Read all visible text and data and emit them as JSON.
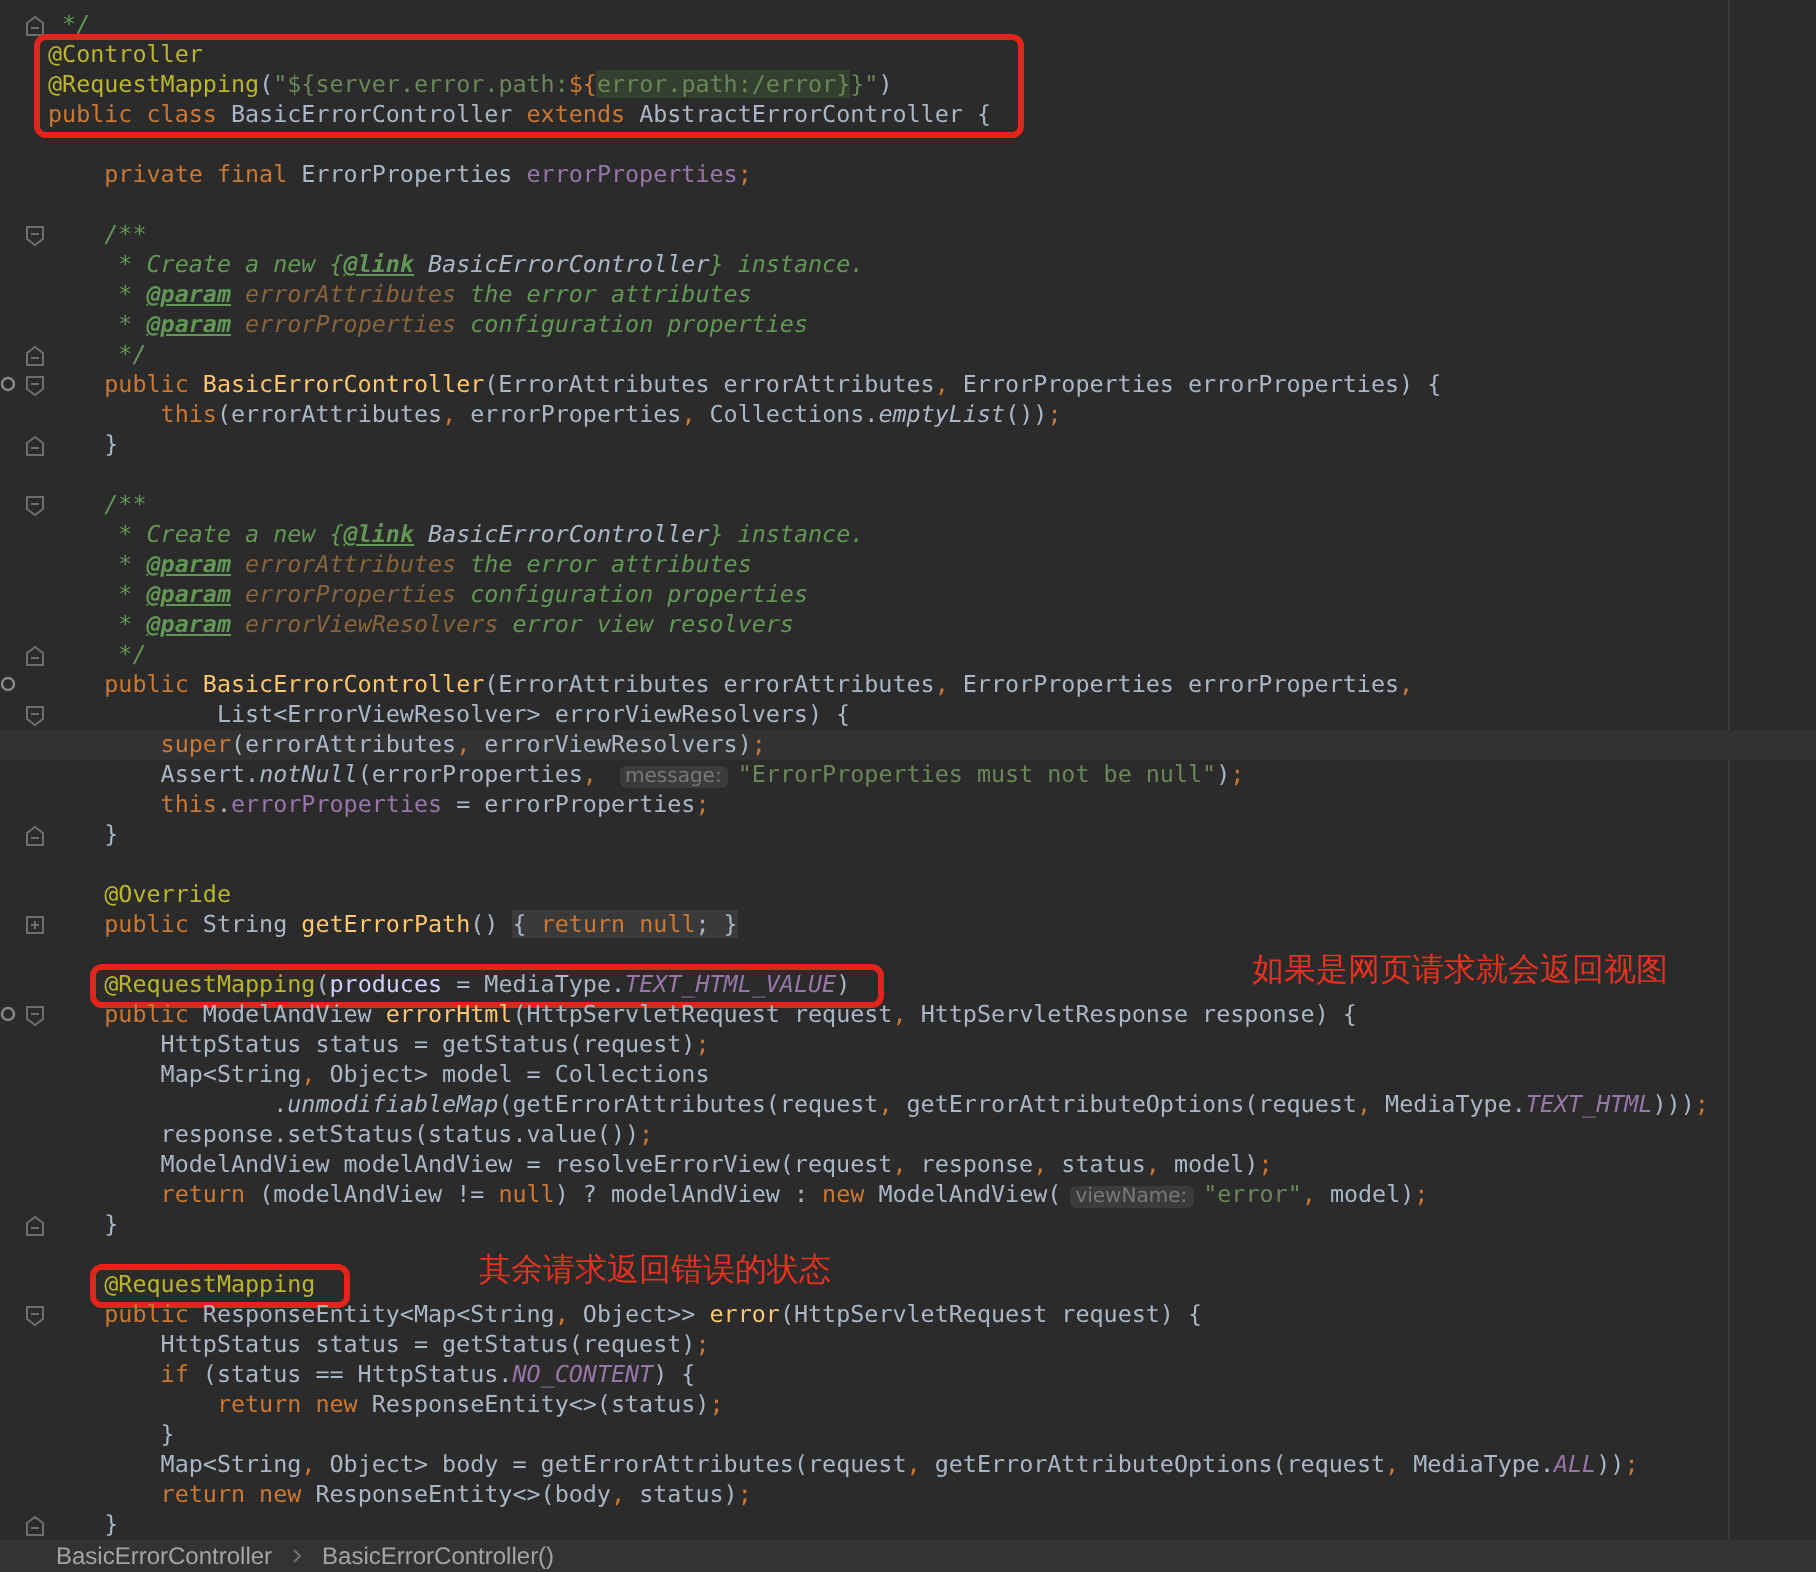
{
  "lines": [
    {
      "kind": "code",
      "fold_end": true,
      "tokens": [
        {
          "kind": "comment",
          "text": " */"
        }
      ]
    },
    {
      "kind": "code",
      "boxed": true,
      "tokens": [
        {
          "kind": "annotation",
          "text": "@Controller"
        }
      ]
    },
    {
      "kind": "code",
      "boxed": true,
      "tokens": [
        {
          "kind": "annotation",
          "text": "@RequestMapping"
        },
        {
          "kind": "plain",
          "text": "("
        },
        {
          "kind": "string",
          "text": "\"${server.error.path:"
        },
        {
          "kind": "keyword",
          "text": "${"
        },
        {
          "kind": "template",
          "text": "error.path:/error}"
        },
        {
          "kind": "string",
          "text": "}\""
        },
        {
          "kind": "plain",
          "text": ")"
        }
      ]
    },
    {
      "kind": "code",
      "boxed": true,
      "tokens": [
        {
          "kind": "keyword",
          "text": "public class "
        },
        {
          "kind": "plain",
          "text": "BasicErrorController "
        },
        {
          "kind": "keyword",
          "text": "extends "
        },
        {
          "kind": "plain",
          "text": "AbstractErrorController {"
        }
      ]
    },
    {
      "kind": "blank"
    },
    {
      "kind": "code",
      "tokens": [
        {
          "kind": "keyword",
          "text": "    private final "
        },
        {
          "kind": "plain",
          "text": "ErrorProperties "
        },
        {
          "kind": "field",
          "text": "errorProperties"
        },
        {
          "kind": "plain",
          "text": ";"
        }
      ]
    },
    {
      "kind": "blank"
    },
    {
      "kind": "code",
      "fold_start": true,
      "tokens": [
        {
          "kind": "comment",
          "text": "    /**"
        }
      ]
    },
    {
      "kind": "code",
      "tokens": [
        {
          "kind": "comment",
          "text": "     * Create a new {"
        },
        {
          "kind": "doctag",
          "text": "@link"
        },
        {
          "kind": "docref",
          "text": " BasicErrorController"
        },
        {
          "kind": "comment",
          "text": "} instance."
        }
      ]
    },
    {
      "kind": "code",
      "tokens": [
        {
          "kind": "comment",
          "text": "     * "
        },
        {
          "kind": "doctag",
          "text": "@param"
        },
        {
          "kind": "docparam",
          "text": " errorAttributes"
        },
        {
          "kind": "comment",
          "text": " the error attributes"
        }
      ]
    },
    {
      "kind": "code",
      "tokens": [
        {
          "kind": "comment",
          "text": "     * "
        },
        {
          "kind": "doctag",
          "text": "@param"
        },
        {
          "kind": "docparam",
          "text": " errorProperties"
        },
        {
          "kind": "comment",
          "text": " configuration properties"
        }
      ]
    },
    {
      "kind": "code",
      "fold_end": true,
      "tokens": [
        {
          "kind": "comment",
          "text": "     */"
        }
      ]
    },
    {
      "kind": "code",
      "fold_start": true,
      "marker": true,
      "tokens": [
        {
          "kind": "keyword",
          "text": "    public "
        },
        {
          "kind": "declaration",
          "text": "BasicErrorController"
        },
        {
          "kind": "plain",
          "text": "(ErrorAttributes errorAttributes, ErrorProperties errorProperties) {"
        }
      ]
    },
    {
      "kind": "code",
      "tokens": [
        {
          "kind": "keyword",
          "text": "        this"
        },
        {
          "kind": "plain",
          "text": "(errorAttributes, errorProperties, Collections."
        },
        {
          "kind": "italic",
          "text": "emptyList"
        },
        {
          "kind": "plain",
          "text": "());"
        }
      ]
    },
    {
      "kind": "code",
      "fold_end": true,
      "tokens": [
        {
          "kind": "plain",
          "text": "    }"
        }
      ]
    },
    {
      "kind": "blank"
    },
    {
      "kind": "code",
      "fold_start": true,
      "tokens": [
        {
          "kind": "comment",
          "text": "    /**"
        }
      ]
    },
    {
      "kind": "code",
      "tokens": [
        {
          "kind": "comment",
          "text": "     * Create a new {"
        },
        {
          "kind": "doctag",
          "text": "@link"
        },
        {
          "kind": "docref",
          "text": " BasicErrorController"
        },
        {
          "kind": "comment",
          "text": "} instance."
        }
      ]
    },
    {
      "kind": "code",
      "tokens": [
        {
          "kind": "comment",
          "text": "     * "
        },
        {
          "kind": "doctag",
          "text": "@param"
        },
        {
          "kind": "docparam",
          "text": " errorAttributes"
        },
        {
          "kind": "comment",
          "text": " the error attributes"
        }
      ]
    },
    {
      "kind": "code",
      "tokens": [
        {
          "kind": "comment",
          "text": "     * "
        },
        {
          "kind": "doctag",
          "text": "@param"
        },
        {
          "kind": "docparam",
          "text": " errorProperties"
        },
        {
          "kind": "comment",
          "text": " configuration properties"
        }
      ]
    },
    {
      "kind": "code",
      "tokens": [
        {
          "kind": "comment",
          "text": "     * "
        },
        {
          "kind": "doctag",
          "text": "@param"
        },
        {
          "kind": "docparam",
          "text": " errorViewResolvers"
        },
        {
          "kind": "comment",
          "text": " error view resolvers"
        }
      ]
    },
    {
      "kind": "code",
      "fold_end": true,
      "tokens": [
        {
          "kind": "comment",
          "text": "     */"
        }
      ]
    },
    {
      "kind": "code",
      "marker": true,
      "tokens": [
        {
          "kind": "keyword",
          "text": "    public "
        },
        {
          "kind": "declaration",
          "text": "BasicErrorController"
        },
        {
          "kind": "plain",
          "text": "(ErrorAttributes errorAttributes, ErrorProperties errorProperties,"
        }
      ]
    },
    {
      "kind": "code",
      "fold_start": true,
      "tokens": [
        {
          "kind": "plain",
          "text": "            List<ErrorViewResolver> errorViewResolvers) {"
        }
      ]
    },
    {
      "kind": "code",
      "current": true,
      "tokens": [
        {
          "kind": "keyword",
          "text": "        super"
        },
        {
          "kind": "plain",
          "text": "(errorAttributes, errorViewResolvers);"
        }
      ]
    },
    {
      "kind": "code",
      "tokens": [
        {
          "kind": "plain",
          "text": "        Assert."
        },
        {
          "kind": "italic",
          "text": "notNull"
        },
        {
          "kind": "plain",
          "text": "(errorProperties, "
        },
        {
          "kind": "hint",
          "text": "message:"
        },
        {
          "kind": "string",
          "text": "\"ErrorProperties must not be null\""
        },
        {
          "kind": "plain",
          "text": ");"
        }
      ]
    },
    {
      "kind": "code",
      "tokens": [
        {
          "kind": "keyword",
          "text": "        this"
        },
        {
          "kind": "plain",
          "text": "."
        },
        {
          "kind": "field",
          "text": "errorProperties"
        },
        {
          "kind": "plain",
          "text": " = errorProperties;"
        }
      ]
    },
    {
      "kind": "code",
      "fold_end": true,
      "tokens": [
        {
          "kind": "plain",
          "text": "    }"
        }
      ]
    },
    {
      "kind": "blank"
    },
    {
      "kind": "code",
      "tokens": [
        {
          "kind": "annotation",
          "text": "    @Override"
        }
      ]
    },
    {
      "kind": "code",
      "folded": true,
      "tokens": [
        {
          "kind": "keyword",
          "text": "    public "
        },
        {
          "kind": "plain",
          "text": "String "
        },
        {
          "kind": "declaration",
          "text": "getErrorPath"
        },
        {
          "kind": "plain",
          "text": "() "
        },
        {
          "kind": "folded",
          "text": "{ "
        },
        {
          "kind": "foldedkeyword",
          "text": "return null"
        },
        {
          "kind": "folded",
          "text": "; }"
        }
      ]
    },
    {
      "kind": "blank"
    },
    {
      "kind": "code",
      "boxed": true,
      "note": "如果是网页请求就会返回视图",
      "tokens": [
        {
          "kind": "annotation",
          "text": "    @RequestMapping"
        },
        {
          "kind": "plain",
          "text": "("
        },
        {
          "kind": "named",
          "text": "produces"
        },
        {
          "kind": "plain",
          "text": " = MediaType."
        },
        {
          "kind": "constant",
          "text": "TEXT_HTML_VALUE"
        },
        {
          "kind": "plain",
          "text": ")"
        }
      ]
    },
    {
      "kind": "code",
      "fold_start": true,
      "marker": true,
      "tokens": [
        {
          "kind": "keyword",
          "text": "    public "
        },
        {
          "kind": "plain",
          "text": "ModelAndView "
        },
        {
          "kind": "declaration",
          "text": "errorHtml"
        },
        {
          "kind": "plain",
          "text": "(HttpServletRequest request, HttpServletResponse response) {"
        }
      ]
    },
    {
      "kind": "code",
      "tokens": [
        {
          "kind": "plain",
          "text": "        HttpStatus status = getStatus(request);"
        }
      ]
    },
    {
      "kind": "code",
      "tokens": [
        {
          "kind": "plain",
          "text": "        Map<String, Object> model = Collections"
        }
      ]
    },
    {
      "kind": "code",
      "tokens": [
        {
          "kind": "plain",
          "text": "                ."
        },
        {
          "kind": "italic",
          "text": "unmodifiableMap"
        },
        {
          "kind": "plain",
          "text": "(getErrorAttributes(request, getErrorAttributeOptions(request, MediaType."
        },
        {
          "kind": "constant",
          "text": "TEXT_HTML"
        },
        {
          "kind": "plain",
          "text": ")));"
        }
      ]
    },
    {
      "kind": "code",
      "tokens": [
        {
          "kind": "plain",
          "text": "        response.setStatus(status.value());"
        }
      ]
    },
    {
      "kind": "code",
      "tokens": [
        {
          "kind": "plain",
          "text": "        ModelAndView modelAndView = resolveErrorView(request, response, status, model);"
        }
      ]
    },
    {
      "kind": "code",
      "tokens": [
        {
          "kind": "keyword",
          "text": "        return "
        },
        {
          "kind": "plain",
          "text": "(modelAndView != "
        },
        {
          "kind": "keyword",
          "text": "null"
        },
        {
          "kind": "plain",
          "text": ") ? modelAndView : "
        },
        {
          "kind": "keyword",
          "text": "new "
        },
        {
          "kind": "plain",
          "text": "ModelAndView("
        },
        {
          "kind": "hint",
          "text": "viewName:"
        },
        {
          "kind": "string",
          "text": "\"error\""
        },
        {
          "kind": "plain",
          "text": ", model);"
        }
      ]
    },
    {
      "kind": "code",
      "fold_end": true,
      "tokens": [
        {
          "kind": "plain",
          "text": "    }"
        }
      ]
    },
    {
      "kind": "blank"
    },
    {
      "kind": "code",
      "boxed": true,
      "note": "其余请求返回错误的状态",
      "tokens": [
        {
          "kind": "annotation",
          "text": "    @RequestMapping"
        }
      ]
    },
    {
      "kind": "code",
      "fold_start": true,
      "tokens": [
        {
          "kind": "keyword",
          "text": "    public "
        },
        {
          "kind": "plain",
          "text": "ResponseEntity<Map<String, Object>> "
        },
        {
          "kind": "declaration",
          "text": "error"
        },
        {
          "kind": "plain",
          "text": "(HttpServletRequest request) {"
        }
      ]
    },
    {
      "kind": "code",
      "tokens": [
        {
          "kind": "plain",
          "text": "        HttpStatus status = getStatus(request);"
        }
      ]
    },
    {
      "kind": "code",
      "tokens": [
        {
          "kind": "keyword",
          "text": "        if "
        },
        {
          "kind": "plain",
          "text": "(status == HttpStatus."
        },
        {
          "kind": "constant",
          "text": "NO_CONTENT"
        },
        {
          "kind": "plain",
          "text": ") {"
        }
      ]
    },
    {
      "kind": "code",
      "tokens": [
        {
          "kind": "keyword",
          "text": "            return new "
        },
        {
          "kind": "plain",
          "text": "ResponseEntity<>(status);"
        }
      ]
    },
    {
      "kind": "code",
      "tokens": [
        {
          "kind": "plain",
          "text": "        }"
        }
      ]
    },
    {
      "kind": "code",
      "tokens": [
        {
          "kind": "plain",
          "text": "        Map<String, Object> body = getErrorAttributes(request, getErrorAttributeOptions(request, MediaType."
        },
        {
          "kind": "constant",
          "text": "ALL"
        },
        {
          "kind": "plain",
          "text": "));"
        }
      ]
    },
    {
      "kind": "code",
      "tokens": [
        {
          "kind": "keyword",
          "text": "        return new "
        },
        {
          "kind": "plain",
          "text": "ResponseEntity<>(body, status);"
        }
      ]
    },
    {
      "kind": "code",
      "fold_end": true,
      "tokens": [
        {
          "kind": "plain",
          "text": "    }"
        }
      ]
    }
  ],
  "breadcrumbs": [
    "BasicErrorController",
    "BasicErrorController()"
  ]
}
